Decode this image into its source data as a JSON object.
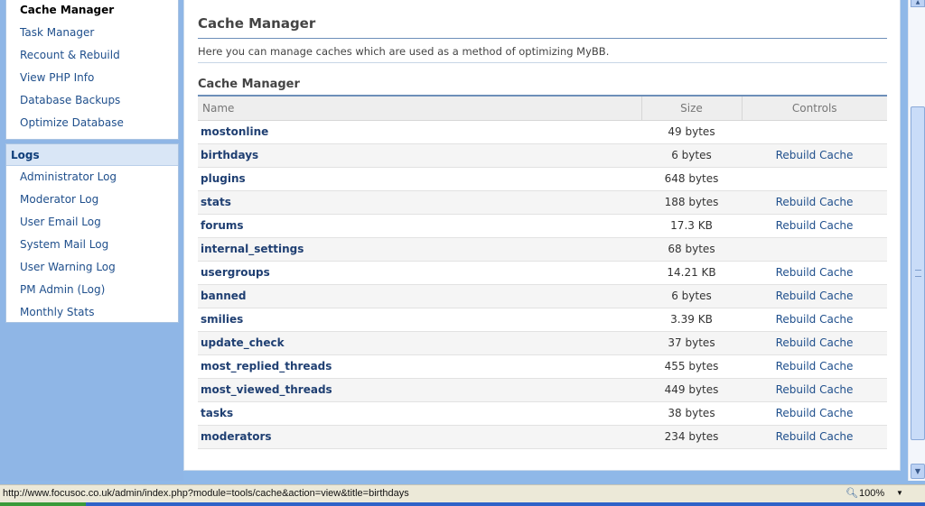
{
  "sidebar": {
    "tools_items": [
      {
        "label": "Cache Manager"
      },
      {
        "label": "Task Manager"
      },
      {
        "label": "Recount & Rebuild"
      },
      {
        "label": "View PHP Info"
      },
      {
        "label": "Database Backups"
      },
      {
        "label": "Optimize Database"
      }
    ],
    "logs_title": "Logs",
    "logs_items": [
      {
        "label": "Administrator Log"
      },
      {
        "label": "Moderator Log"
      },
      {
        "label": "User Email Log"
      },
      {
        "label": "System Mail Log"
      },
      {
        "label": "User Warning Log"
      },
      {
        "label": "PM Admin (Log)"
      },
      {
        "label": "Monthly Stats"
      }
    ]
  },
  "main": {
    "title": "Cache Manager",
    "description": "Here you can manage caches which are used as a method of optimizing MyBB.",
    "table_title": "Cache Manager",
    "columns": {
      "name": "Name",
      "size": "Size",
      "controls": "Controls"
    },
    "rows": [
      {
        "name": "mostonline",
        "size": "49 bytes",
        "control": ""
      },
      {
        "name": "birthdays",
        "size": "6 bytes",
        "control": "Rebuild Cache"
      },
      {
        "name": "plugins",
        "size": "648 bytes",
        "control": ""
      },
      {
        "name": "stats",
        "size": "188 bytes",
        "control": "Rebuild Cache"
      },
      {
        "name": "forums",
        "size": "17.3 KB",
        "control": "Rebuild Cache"
      },
      {
        "name": "internal_settings",
        "size": "68 bytes",
        "control": ""
      },
      {
        "name": "usergroups",
        "size": "14.21 KB",
        "control": "Rebuild Cache"
      },
      {
        "name": "banned",
        "size": "6 bytes",
        "control": "Rebuild Cache"
      },
      {
        "name": "smilies",
        "size": "3.39 KB",
        "control": "Rebuild Cache"
      },
      {
        "name": "update_check",
        "size": "37 bytes",
        "control": "Rebuild Cache"
      },
      {
        "name": "most_replied_threads",
        "size": "455 bytes",
        "control": "Rebuild Cache"
      },
      {
        "name": "most_viewed_threads",
        "size": "449 bytes",
        "control": "Rebuild Cache"
      },
      {
        "name": "tasks",
        "size": "38 bytes",
        "control": "Rebuild Cache"
      },
      {
        "name": "moderators",
        "size": "234 bytes",
        "control": "Rebuild Cache"
      }
    ]
  },
  "statusbar": {
    "url": "http://www.focusoc.co.uk/admin/index.php?module=tools/cache&action=view&title=birthdays",
    "zoom": "100%"
  }
}
